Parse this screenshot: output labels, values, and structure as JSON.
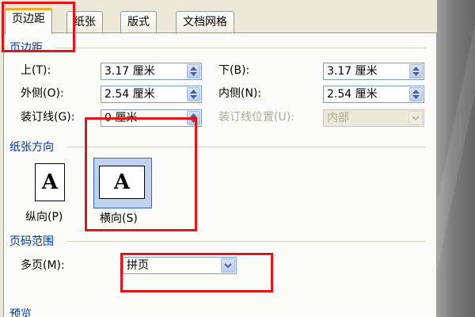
{
  "tabs": [
    {
      "label": "页边距",
      "active": true
    },
    {
      "label": "纸张",
      "active": false
    },
    {
      "label": "版式",
      "active": false
    },
    {
      "label": "文档网格",
      "active": false
    }
  ],
  "margins": {
    "title": "页边距",
    "top_label": "上(T):",
    "top_value": "3.17 厘米",
    "bottom_label": "下(B):",
    "bottom_value": "3.17 厘米",
    "outside_label": "外侧(O):",
    "outside_value": "2.54 厘米",
    "inside_label": "内侧(N):",
    "inside_value": "2.54 厘米",
    "gutter_label": "装订线(G):",
    "gutter_value": "0 厘米",
    "gutter_pos_label": "装订线位置(U):",
    "gutter_pos_value": "内部"
  },
  "orientation": {
    "title": "纸张方向",
    "portrait_label": "纵向(P)",
    "landscape_label": "横向(S)",
    "selected": "landscape",
    "icon_letter": "A"
  },
  "pages": {
    "title": "页码范围",
    "multiple_label": "多页(M):",
    "multiple_value": "拼页"
  },
  "preview": {
    "title": "预览"
  },
  "colors": {
    "highlight": "#e3151a",
    "section_title": "#003399",
    "dialog_bg": "#ece9d8"
  }
}
